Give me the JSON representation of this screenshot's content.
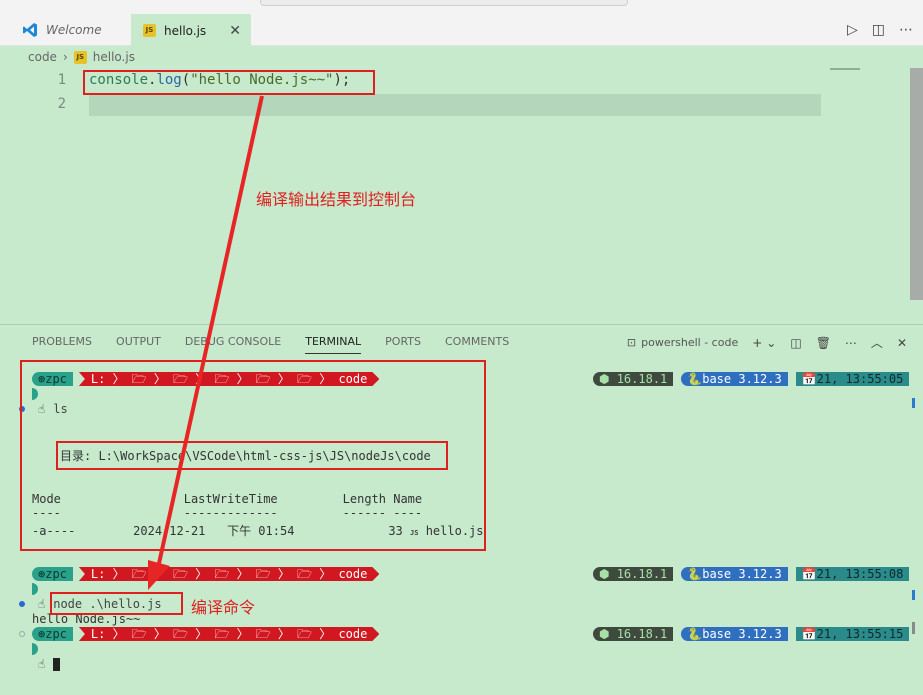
{
  "tabs": [
    {
      "label": "Welcome",
      "icon": "vscode-icon"
    },
    {
      "label": "hello.js",
      "icon": "js-file-icon",
      "badge": "JS",
      "active": true
    }
  ],
  "breadcrumb": {
    "folder": "code",
    "file": "hello.js"
  },
  "editor": {
    "line_numbers": [
      "1",
      "2"
    ],
    "code": {
      "obj": "console",
      "dot": ".",
      "fn": "log",
      "open": "(",
      "str": "\"hello Node.js~~\"",
      "close": ");"
    }
  },
  "annotations": {
    "output_note": "编译输出结果到控制台",
    "command_note": "编译命令"
  },
  "panel": {
    "tabs": [
      "PROBLEMS",
      "OUTPUT",
      "DEBUG CONSOLE",
      "TERMINAL",
      "PORTS",
      "COMMENTS"
    ],
    "active_tab": "TERMINAL",
    "shell_label": "powershell - code",
    "add": "+",
    "chevron": "⌄"
  },
  "terminal": {
    "user": "⊛zpc",
    "path": "L: 〉 🗁 〉 🗁 〉 🗁 〉 🗁 〉 🗁 〉 code",
    "node": "⬢ 16.18.1",
    "python": "🐍base 3.12.3",
    "times": [
      "📅21, 13:55:05",
      "📅21, 13:55:08",
      "📅21, 13:55:15"
    ],
    "prompt_glyph": "☝",
    "cmd1": "ls",
    "dir_label": "目录: L:\\WorkSpace\\VSCode\\html-css-js\\JS\\nodeJs\\code",
    "header_line": "Mode                 LastWriteTime         Length Name",
    "dash_line": "----                 -------------         ------ ----",
    "row_line": "-a----        2024-12-21   下午 01:54             33",
    "row_badge": "JS",
    "row_file": "hello.js",
    "cmd2": "node .\\hello.js",
    "output": "hello Node.js~~"
  },
  "colors": {
    "background": "#c7e9cc",
    "annotation": "#e02020",
    "path_segment": "#d1171f"
  }
}
